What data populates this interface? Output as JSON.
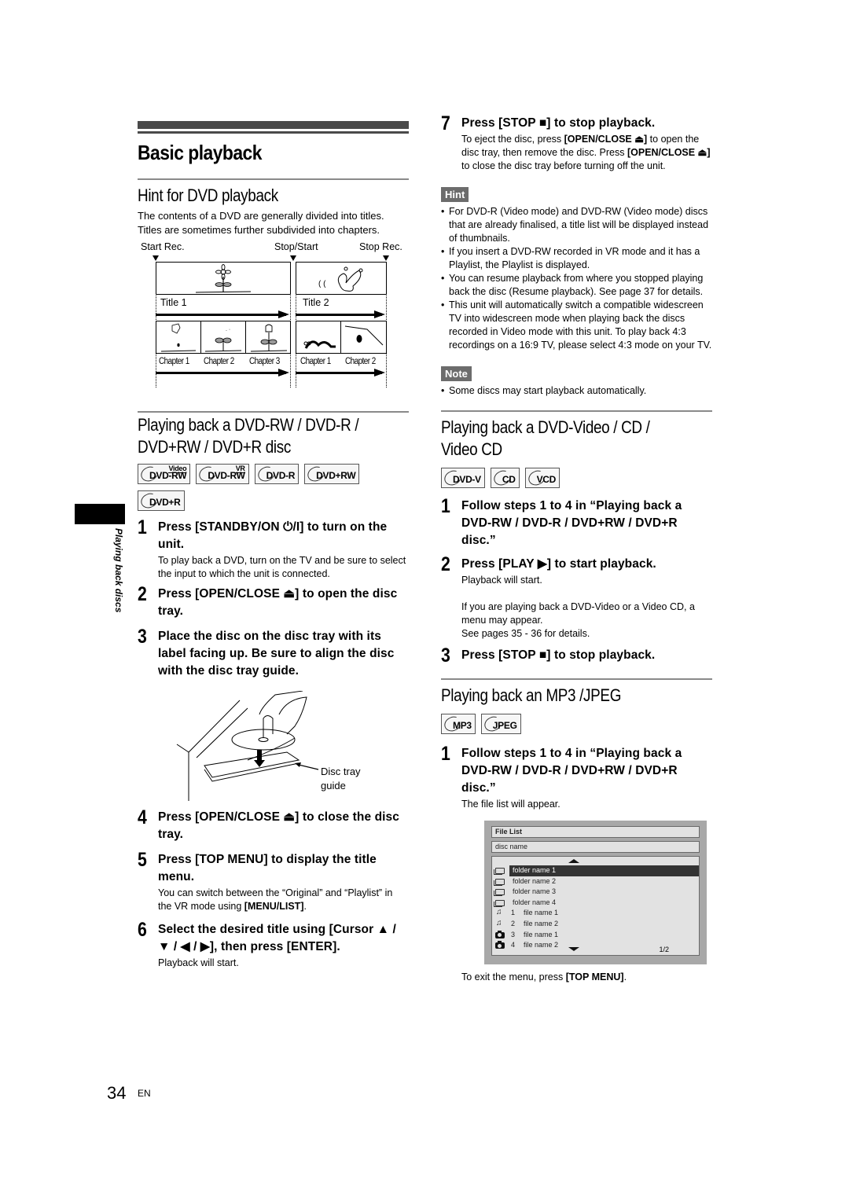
{
  "page": {
    "number": "34",
    "lang": "EN",
    "side_label": "Playing back discs"
  },
  "title": "Basic playback",
  "hint_section": {
    "title": "Hint for DVD playback",
    "intro": "The contents of a DVD are generally divided into titles. Titles are sometimes further subdivided into chapters.",
    "diagram": {
      "markers": [
        "Start Rec.",
        "Stop/Start",
        "Stop Rec."
      ],
      "titles": [
        "Title 1",
        "Title 2"
      ],
      "title1_chapters": [
        "Chapter 1",
        "Chapter 2",
        "Chapter 3"
      ],
      "title2_chapters": [
        "Chapter 1",
        "Chapter 2"
      ]
    }
  },
  "dvdrw_section": {
    "title": "Playing back a DVD-RW / DVD-R / DVD+RW / DVD+R disc",
    "title_line1": "Playing back a DVD-RW / DVD-R /",
    "title_line2": "DVD+RW / DVD+R disc",
    "discs": [
      {
        "label": "DVD-RW",
        "sup": "Video"
      },
      {
        "label": "DVD-RW",
        "sup": "VR"
      },
      {
        "label": "DVD-R",
        "sup": ""
      },
      {
        "label": "DVD+RW",
        "sup": ""
      },
      {
        "label": "DVD+R",
        "sup": ""
      }
    ],
    "steps": [
      {
        "num": "1",
        "head": "Press [STANDBY/ON ⏻/I] to turn on the unit.",
        "desc": "To play back a DVD, turn on the TV and be sure to select the input to which the unit is connected."
      },
      {
        "num": "2",
        "head": "Press [OPEN/CLOSE ⏏] to open the disc tray.",
        "desc": ""
      },
      {
        "num": "3",
        "head": "Place the disc on the disc tray with its label facing up. Be sure to align the disc with the disc tray guide.",
        "desc": ""
      },
      {
        "num": "4",
        "head": "Press [OPEN/CLOSE ⏏] to close the disc tray.",
        "desc": ""
      },
      {
        "num": "5",
        "head": "Press [TOP MENU] to display the title menu.",
        "desc_pre": "You can switch between the “Original” and “Playlist” in the VR mode using ",
        "desc_bold": "[MENU/LIST]",
        "desc_post": "."
      },
      {
        "num": "6",
        "head": "Select the desired title using [Cursor ▲ / ▼ / ◀ / ▶], then press [ENTER].",
        "desc": "Playback will start."
      },
      {
        "num": "7",
        "head": "Press [STOP ■] to stop playback.",
        "desc_parts": [
          "To eject the disc, press ",
          "[OPEN/CLOSE ⏏]",
          " to open the disc tray, then remove the disc. Press ",
          "[OPEN/CLOSE ⏏]",
          " to close the disc tray before turning off the unit."
        ]
      }
    ],
    "illustration_callout": "Disc tray guide"
  },
  "hint_box": {
    "label": "Hint",
    "items": [
      "For DVD-R (Video mode) and DVD-RW (Video mode) discs that are already finalised, a title list will be displayed instead of thumbnails.",
      "If you insert a DVD-RW recorded in VR mode and it has a Playlist, the Playlist is displayed.",
      "You can resume playback from where you stopped playing back the disc (Resume playback). See page 37 for details.",
      "This unit will automatically switch a compatible widescreen TV into widescreen mode when playing back the discs recorded in Video mode with this unit. To play back 4:3 recordings on a 16:9 TV, please select 4:3 mode on your TV."
    ]
  },
  "note_box": {
    "label": "Note",
    "items": [
      "Some discs may start playback automatically."
    ]
  },
  "dvdvideo_section": {
    "title_line1": "Playing back a DVD-Video / CD /",
    "title_line2": "Video CD",
    "discs": [
      {
        "label": "DVD-V"
      },
      {
        "label": "CD"
      },
      {
        "label": "VCD"
      }
    ],
    "steps": [
      {
        "num": "1",
        "head": "Follow steps 1 to 4 in “Playing back a DVD-RW / DVD-R / DVD+RW / DVD+R disc.”"
      },
      {
        "num": "2",
        "head": "Press [PLAY ▶] to start playback.",
        "desc": "Playback will start.",
        "desc2": "If you are playing back a DVD-Video or a Video CD, a menu may appear.",
        "desc3": "See pages 35 - 36 for details."
      },
      {
        "num": "3",
        "head": "Press [STOP ■] to stop playback."
      }
    ]
  },
  "mp3_section": {
    "title": "Playing back an MP3 /JPEG",
    "discs": [
      {
        "label": "MP3"
      },
      {
        "label": "JPEG"
      }
    ],
    "steps": [
      {
        "num": "1",
        "head": "Follow steps 1 to 4 in “Playing back a DVD-RW / DVD-R / DVD+RW / DVD+R disc.”",
        "desc": "The file list will appear."
      }
    ],
    "file_list": {
      "title": "File List",
      "disc_name": "disc name",
      "page": "1/2",
      "rows": [
        {
          "type": "folder",
          "name": "folder name 1",
          "selected": true
        },
        {
          "type": "folder",
          "name": "folder name 2"
        },
        {
          "type": "folder",
          "name": "folder name 3"
        },
        {
          "type": "folder",
          "name": "folder name 4"
        },
        {
          "type": "music",
          "index": "1",
          "name": "file name 1"
        },
        {
          "type": "music",
          "index": "2",
          "name": "file name 2"
        },
        {
          "type": "photo",
          "index": "3",
          "name": "file name 1"
        },
        {
          "type": "photo",
          "index": "4",
          "name": "file name 2"
        }
      ]
    },
    "exit_pre": "To exit the menu, press ",
    "exit_bold": "[TOP MENU]",
    "exit_post": "."
  }
}
